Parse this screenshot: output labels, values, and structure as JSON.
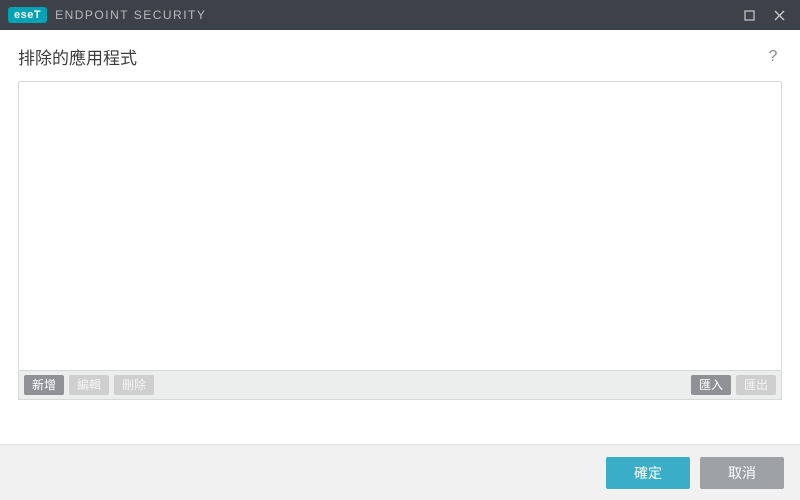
{
  "titlebar": {
    "logo_text": "eseT",
    "app_name": "ENDPOINT SECURITY"
  },
  "page": {
    "title": "排除的應用程式",
    "help_symbol": "?"
  },
  "list": {
    "items": []
  },
  "actionbar": {
    "add_label": "新增",
    "edit_label": "編輯",
    "delete_label": "刪除",
    "import_label": "匯入",
    "export_label": "匯出"
  },
  "footer": {
    "ok_label": "確定",
    "cancel_label": "取消"
  }
}
